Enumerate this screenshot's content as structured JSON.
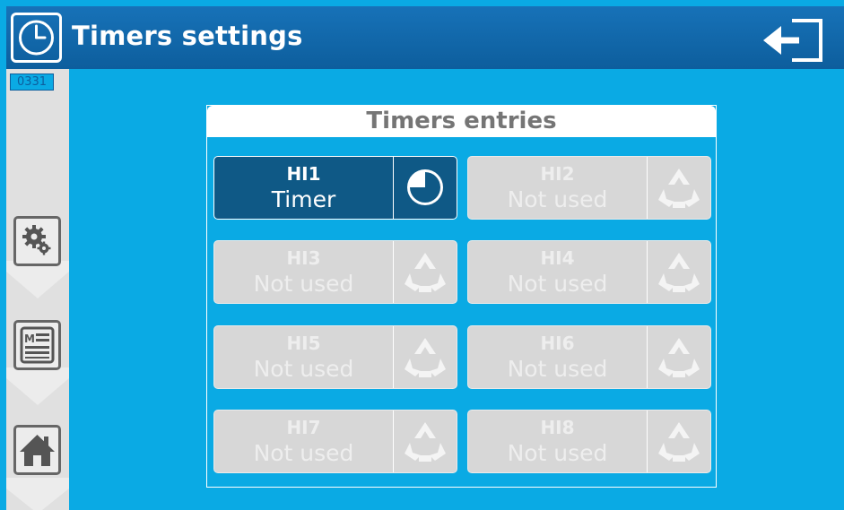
{
  "header": {
    "title": "Timers settings",
    "clock_icon": "clock-icon",
    "exit_icon": "exit-icon"
  },
  "sidebar": {
    "counter": "0331",
    "buttons": [
      {
        "name": "settings",
        "icon": "gears-icon"
      },
      {
        "name": "menu",
        "icon": "menu-list-icon"
      },
      {
        "name": "home",
        "icon": "home-icon"
      }
    ]
  },
  "panel": {
    "title": "Timers entries",
    "entries": [
      {
        "code": "HI1",
        "state": "Timer",
        "active": true,
        "icon": "timer-pie-icon"
      },
      {
        "code": "HI2",
        "state": "Not used",
        "active": false,
        "icon": "recycle-icon"
      },
      {
        "code": "HI3",
        "state": "Not used",
        "active": false,
        "icon": "recycle-icon"
      },
      {
        "code": "HI4",
        "state": "Not used",
        "active": false,
        "icon": "recycle-icon"
      },
      {
        "code": "HI5",
        "state": "Not used",
        "active": false,
        "icon": "recycle-icon"
      },
      {
        "code": "HI6",
        "state": "Not used",
        "active": false,
        "icon": "recycle-icon"
      },
      {
        "code": "HI7",
        "state": "Not used",
        "active": false,
        "icon": "recycle-icon"
      },
      {
        "code": "HI8",
        "state": "Not used",
        "active": false,
        "icon": "recycle-icon"
      }
    ]
  },
  "colors": {
    "background": "#0aaae4",
    "header": "#1772b8",
    "active_entry": "#0f5986",
    "inactive_entry": "#d7d7d7"
  }
}
